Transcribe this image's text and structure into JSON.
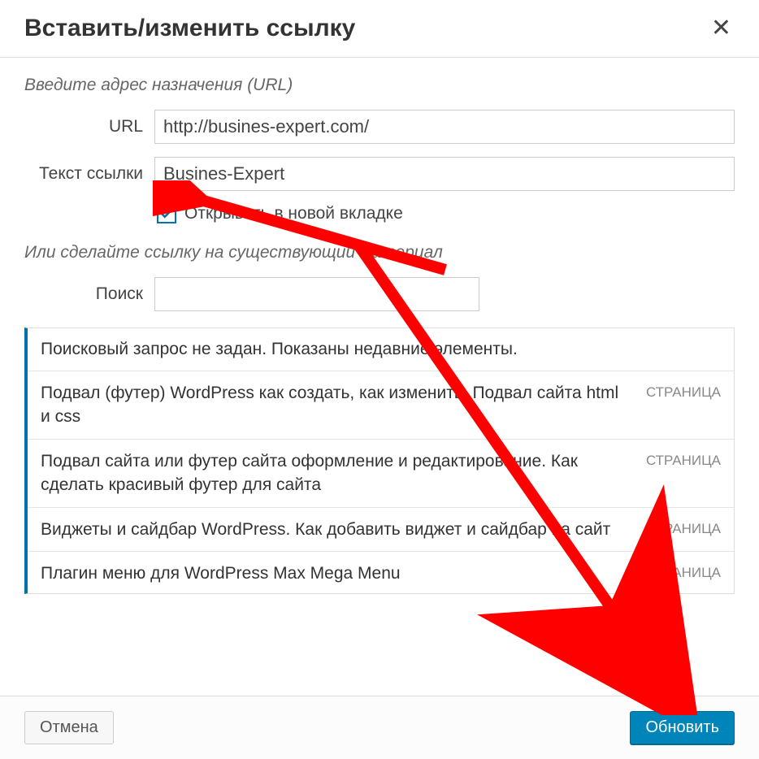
{
  "dialog": {
    "title": "Вставить/изменить ссылку",
    "sectionUrl": "Введите адрес назначения (URL)",
    "urlLabel": "URL",
    "urlValue": "http://busines-expert.com/",
    "linkTextLabel": "Текст ссылки",
    "linkTextValue": "Busines-Expert",
    "newTabLabel": "Открывать в новой вкладке",
    "newTabChecked": true,
    "sectionExisting": "Или сделайте ссылку на существующий материал",
    "searchLabel": "Поиск",
    "searchValue": "",
    "resultsHeader": "Поисковый запрос не задан. Показаны недавние элементы.",
    "results": [
      {
        "title": "Подвал (футер) WordPress как создать, как изменить. Подвал сайта html и css",
        "type": "СТРАНИЦА"
      },
      {
        "title": "Подвал сайта или футер сайта оформление и редактирование. Как сделать красивый футер для сайта",
        "type": "СТРАНИЦА"
      },
      {
        "title": "Виджеты и сайдбар WordPress. Как добавить виджет и сайдбар на сайт",
        "type": "СТРАНИЦА"
      },
      {
        "title": "Плагин меню для WordPress Max Mega Menu",
        "type": "СТРАНИЦА"
      }
    ],
    "cancelLabel": "Отмена",
    "submitLabel": "Обновить"
  }
}
